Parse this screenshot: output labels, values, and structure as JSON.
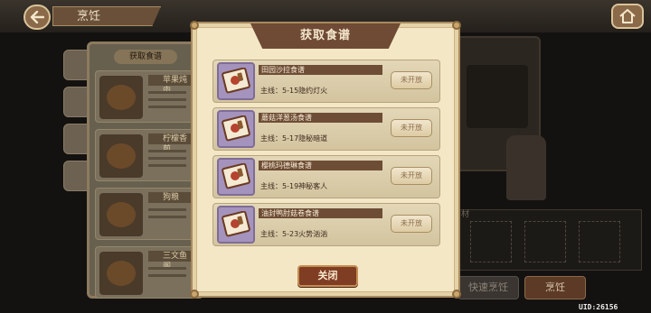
{
  "background": {
    "title": "烹饪",
    "panel_header": "获取食谱",
    "items": [
      {
        "name": "苹果炖肉"
      },
      {
        "name": "柠檬香煎"
      },
      {
        "name": "狗粮"
      },
      {
        "name": "三文鱼阁"
      }
    ],
    "material_label": "材",
    "quick_cook_label": "快速烹饪",
    "cook_label": "烹饪",
    "uid": "UID:26156"
  },
  "modal": {
    "title": "获取食谱",
    "recipes": [
      {
        "name": "田园沙拉食谱",
        "quest": "主线：5-15隐约灯火",
        "status": "未开放"
      },
      {
        "name": "蘑菇洋葱汤食谱",
        "quest": "主线：5-17隐秘暗道",
        "status": "未开放"
      },
      {
        "name": "樱桃玛德琳食谱",
        "quest": "主线：5-19神秘客人",
        "status": "未开放"
      },
      {
        "name": "油封鸭肘菇卷食谱",
        "quest": "主线：5-23火势汹汹",
        "status": "未开放"
      }
    ],
    "close_label": "关闭"
  },
  "colors": {
    "modal_bg": "#f3e7c6",
    "title_bar": "#6f4a34",
    "close_button": "#7f3e23",
    "icon_frame": "#a493bd"
  },
  "icons": [
    "back-arrow-icon",
    "home-icon",
    "recipe-book-icon"
  ]
}
